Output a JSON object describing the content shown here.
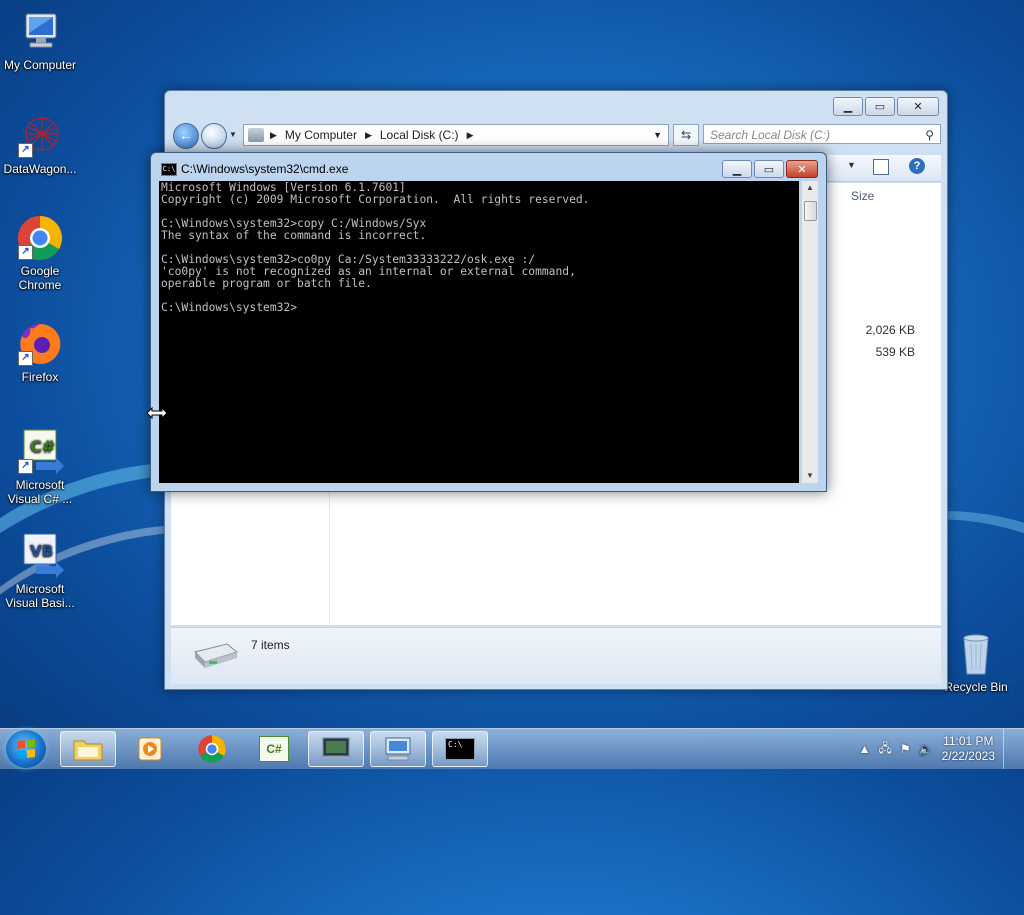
{
  "desktop": {
    "icons": [
      {
        "label": "My Computer"
      },
      {
        "label": "DataWagon..."
      },
      {
        "label": "Google Chrome"
      },
      {
        "label": "Firefox"
      },
      {
        "label": "Microsoft Visual C# ..."
      },
      {
        "label": "Microsoft Visual Basi..."
      },
      {
        "label": "Recycle Bin"
      }
    ]
  },
  "explorer": {
    "breadcrumb": [
      "My Computer",
      "Local Disk (C:)"
    ],
    "search_placeholder": "Search Local Disk (C:)",
    "column_size": "Size",
    "sizes": [
      "2,026 KB",
      "539 KB"
    ],
    "status_text": "7 items"
  },
  "cmd": {
    "title": "C:\\Windows\\system32\\cmd.exe",
    "sys_icon_text": "C:\\",
    "output": "Microsoft Windows [Version 6.1.7601]\nCopyright (c) 2009 Microsoft Corporation.  All rights reserved.\n\nC:\\Windows\\system32>copy C:/Windows/Syx\nThe syntax of the command is incorrect.\n\nC:\\Windows\\system32>co0py Ca:/System33333222/osk.exe :/\n'co0py' is not recognized as an internal or external command,\noperable program or batch file.\n\nC:\\Windows\\system32>"
  },
  "taskbar": {
    "clock_time": "11:01 PM",
    "clock_date": "2/22/2023",
    "csharp_label": "C#"
  },
  "colors": {
    "console_bg": "#000000",
    "console_fg": "#c0c0c0",
    "desktop_blue": "#1a6fc4",
    "close_red": "#c24228"
  }
}
